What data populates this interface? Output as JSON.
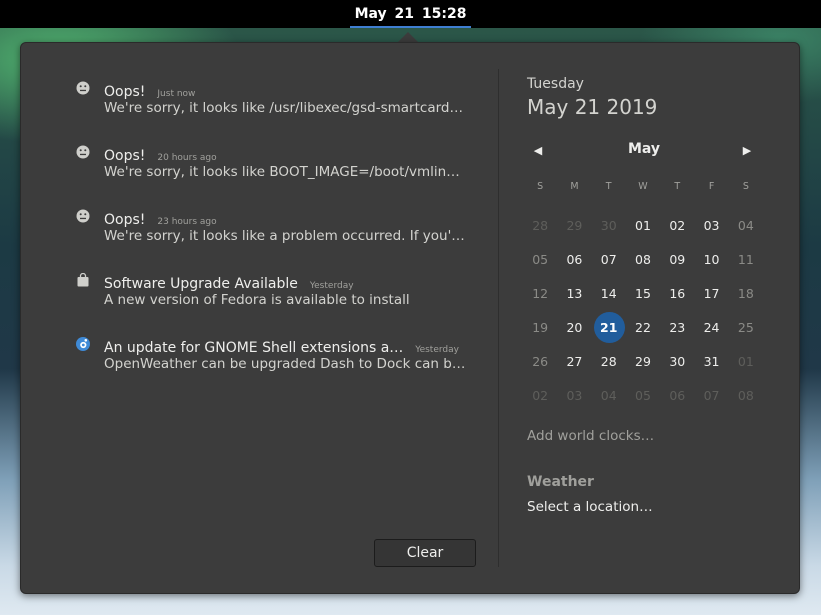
{
  "topbar": {
    "clock": "May 21  15:28"
  },
  "notifications": [
    {
      "icon": "face-sad-icon",
      "title": "Oops!",
      "time": "Just now",
      "body": "We're sorry, it looks like /usr/libexec/gsd-smartcard c…"
    },
    {
      "icon": "face-sad-icon",
      "title": "Oops!",
      "time": "20 hours ago",
      "body": "We're sorry, it looks like BOOT_IMAGE=/boot/vmlinu…"
    },
    {
      "icon": "face-sad-icon",
      "title": "Oops!",
      "time": "23 hours ago",
      "body": "We're sorry, it looks like a problem occurred. If you'd li…"
    },
    {
      "icon": "shopping-bag-icon",
      "title": "Software Upgrade Available",
      "time": "Yesterday",
      "body": "A new version of Fedora is available to install"
    },
    {
      "icon": "gnome-extensions-icon",
      "title": "An update for GNOME Shell extensions a…",
      "time": "Yesterday",
      "body": "OpenWeather can be upgraded Dash to Dock can be u…"
    }
  ],
  "clear_label": "Clear",
  "calendar": {
    "day_name": "Tuesday",
    "full_date": "May 21 2019",
    "month": "May",
    "weekdays": [
      "S",
      "M",
      "T",
      "W",
      "T",
      "F",
      "S"
    ],
    "weeks": [
      [
        "28",
        "29",
        "30",
        "01",
        "02",
        "03",
        "04"
      ],
      [
        "05",
        "06",
        "07",
        "08",
        "09",
        "10",
        "11"
      ],
      [
        "12",
        "13",
        "14",
        "15",
        "16",
        "17",
        "18"
      ],
      [
        "19",
        "20",
        "21",
        "22",
        "23",
        "24",
        "25"
      ],
      [
        "26",
        "27",
        "28",
        "29",
        "30",
        "31",
        "01"
      ],
      [
        "02",
        "03",
        "04",
        "05",
        "06",
        "07",
        "08"
      ]
    ],
    "today": "21",
    "accent_color": "#215d9c"
  },
  "world_clocks_label": "Add world clocks…",
  "weather": {
    "title": "Weather",
    "location_label": "Select a location…"
  }
}
